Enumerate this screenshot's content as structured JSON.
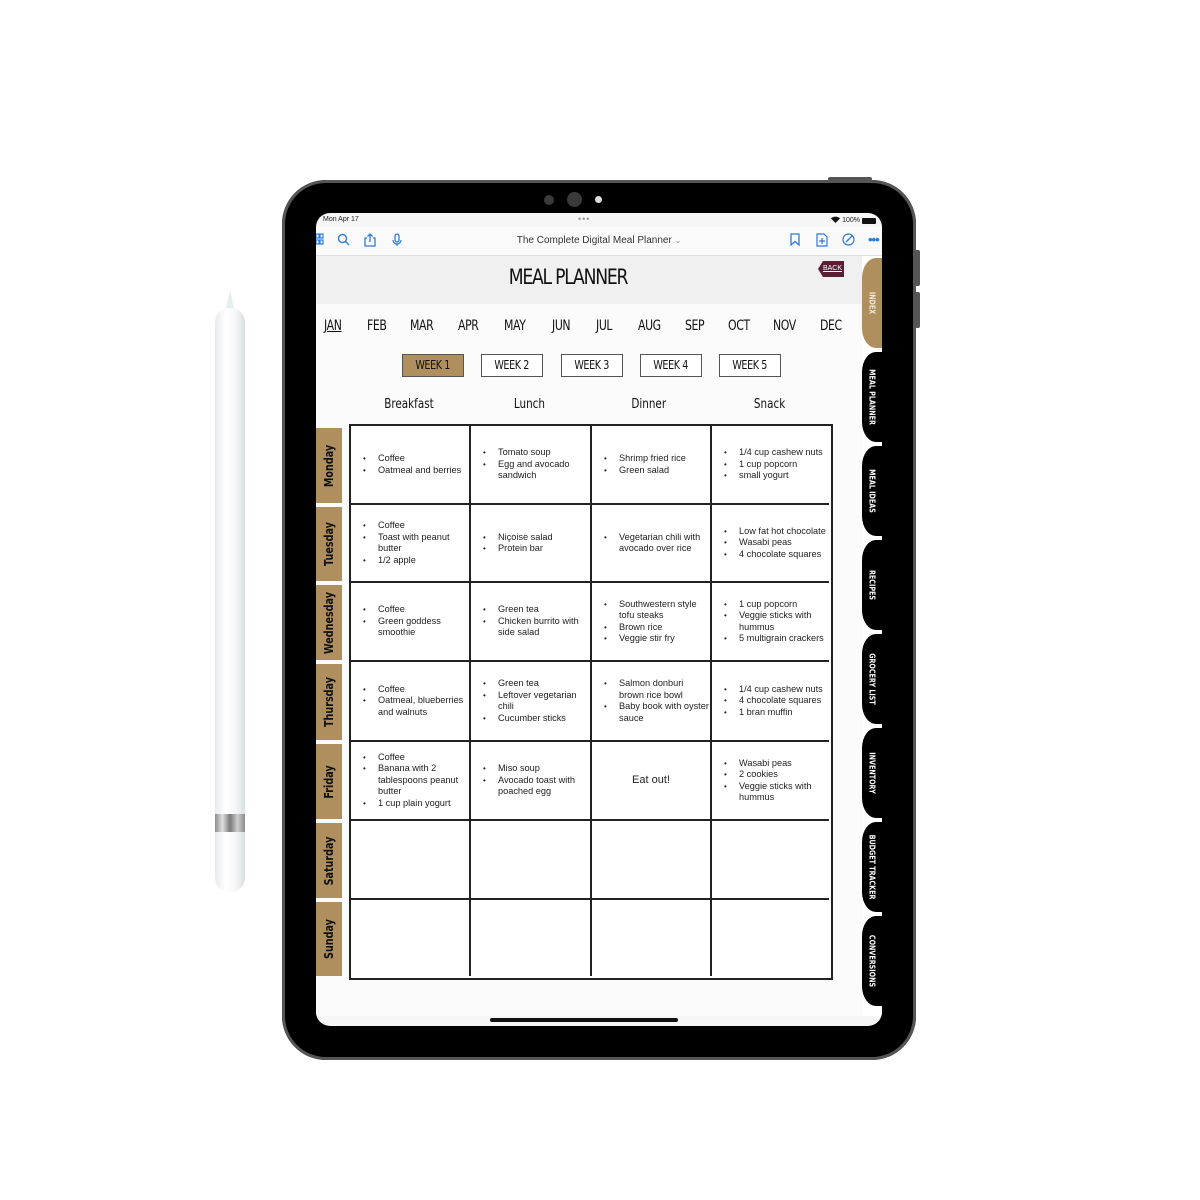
{
  "statusbar": {
    "time": "Mon Apr 17",
    "dots": "•••",
    "battery": "100%",
    "wifi_icon": "wifi-icon"
  },
  "toolbar": {
    "title": "The Complete Digital Meal Planner",
    "title_caret": "⌄",
    "left_icons": [
      "grid-icon",
      "search-icon",
      "share-icon",
      "microphone-icon"
    ],
    "right_icons": [
      "bookmark-icon",
      "add-page-icon",
      "markup-icon",
      "more-icon"
    ]
  },
  "page": {
    "title": "MEAL PLANNER",
    "back_label": "BACK",
    "months": [
      "JAN",
      "FEB",
      "MAR",
      "APR",
      "MAY",
      "JUN",
      "JUL",
      "AUG",
      "SEP",
      "OCT",
      "NOV",
      "DEC"
    ],
    "active_month": "JAN",
    "weeks": [
      "WEEK 1",
      "WEEK 2",
      "WEEK 3",
      "WEEK 4",
      "WEEK 5"
    ],
    "active_week": "WEEK 1",
    "columns": [
      "Breakfast",
      "Lunch",
      "Dinner",
      "Snack"
    ],
    "days": [
      {
        "name": "Monday",
        "meals": [
          [
            "Coffee",
            "Oatmeal and berries"
          ],
          [
            "Tomato soup",
            "Egg and avocado sandwich"
          ],
          [
            "Shrimp fried rice",
            "Green salad"
          ],
          [
            "1/4 cup cashew nuts",
            "1 cup popcorn",
            "small yogurt"
          ]
        ]
      },
      {
        "name": "Tuesday",
        "meals": [
          [
            "Coffee",
            "Toast with peanut butter",
            "1/2 apple"
          ],
          [
            "Niçoise salad",
            "Protein bar"
          ],
          [
            "Vegetarian chili with avocado over rice"
          ],
          [
            "Low fat hot chocolate",
            "Wasabi peas",
            "4 chocolate squares"
          ]
        ]
      },
      {
        "name": "Wednesday",
        "meals": [
          [
            "Coffee",
            "Green goddess smoothie"
          ],
          [
            "Green tea",
            "Chicken burrito with side salad"
          ],
          [
            "Southwestern style tofu steaks",
            "Brown rice",
            "Veggie stir fry"
          ],
          [
            "1 cup popcorn",
            "Veggie sticks with hummus",
            "5 multigrain crackers"
          ]
        ]
      },
      {
        "name": "Thursday",
        "meals": [
          [
            "Coffee",
            "Oatmeal, blueberries and walnuts"
          ],
          [
            "Green tea",
            "Leftover vegetarian chili",
            "Cucumber sticks"
          ],
          [
            "Salmon donburi brown rice bowl",
            "Baby book with oyster sauce"
          ],
          [
            "1/4 cup cashew nuts",
            "4 chocolate squares",
            "1 bran muffin"
          ]
        ]
      },
      {
        "name": "Friday",
        "meals": [
          [
            "Coffee",
            "Banana with 2 tablespoons peanut butter",
            "1 cup plain yogurt"
          ],
          [
            "Miso soup",
            "Avocado toast with poached egg"
          ],
          "Eat out!",
          [
            "Wasabi peas",
            "2 cookies",
            "Veggie sticks with hummus"
          ]
        ]
      },
      {
        "name": "Saturday",
        "meals": [
          [],
          [],
          [],
          []
        ]
      },
      {
        "name": "Sunday",
        "meals": [
          [],
          [],
          [],
          []
        ]
      }
    ]
  },
  "side_tabs": [
    "INDEX",
    "MEAL PLANNER",
    "MEAL IDEAS",
    "RECIPES",
    "GROCERY LIST",
    "INVENTORY",
    "BUDGET TRACKER",
    "CONVERSIONS"
  ],
  "active_side_tab": "INDEX",
  "colors": {
    "accent": "#b08f5e",
    "back_button": "#5a1f35",
    "toolbar_icon": "#2f7bd6",
    "tab_dark": "#000000"
  }
}
